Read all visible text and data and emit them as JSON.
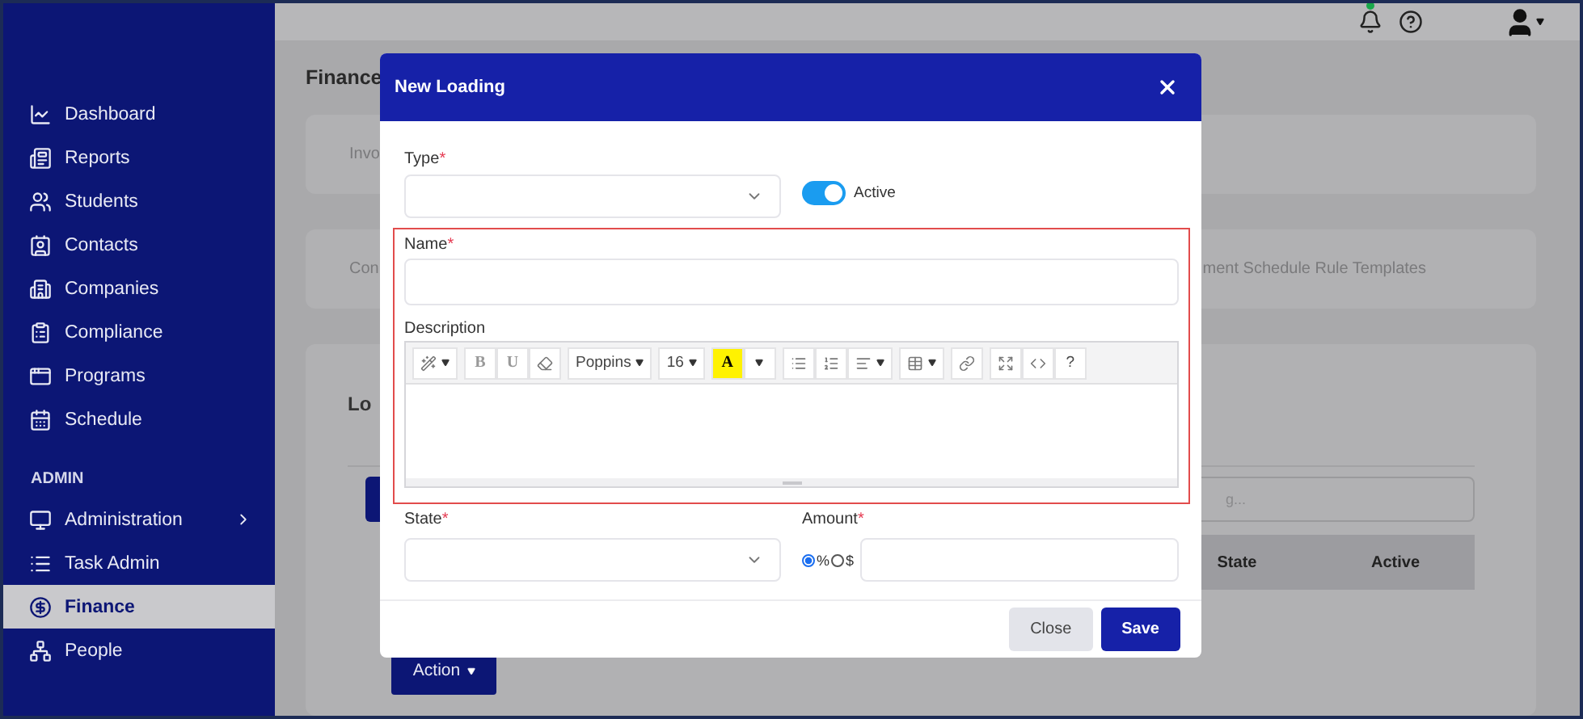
{
  "sidebar": {
    "items": [
      {
        "label": "Dashboard",
        "selected": false
      },
      {
        "label": "Reports",
        "selected": false
      },
      {
        "label": "Students",
        "selected": false
      },
      {
        "label": "Contacts",
        "selected": false
      },
      {
        "label": "Companies",
        "selected": false
      },
      {
        "label": "Compliance",
        "selected": false
      },
      {
        "label": "Programs",
        "selected": false
      },
      {
        "label": "Schedule",
        "selected": false
      }
    ],
    "section": "ADMIN",
    "admin_items": [
      {
        "label": "Administration",
        "selected": false,
        "expandable": true
      },
      {
        "label": "Task Admin",
        "selected": false,
        "expandable": false
      },
      {
        "label": "Finance",
        "selected": true,
        "expandable": false
      },
      {
        "label": "People",
        "selected": false,
        "expandable": false
      }
    ]
  },
  "header": {
    "notification_dot": true
  },
  "page": {
    "title": "Finance",
    "card_1": {
      "text": "Invo"
    },
    "card_2": {
      "left": "Con",
      "right": "ment Schedule Rule Templates"
    },
    "panel": {
      "title": "Lo",
      "search": {
        "placeholder": "g..."
      },
      "table_columns": [
        "State",
        "Active"
      ],
      "action_button": "Action"
    }
  },
  "modal": {
    "title": "New Loading",
    "type": {
      "label": "Type",
      "required_mark": "*"
    },
    "active": {
      "label": "Active",
      "on": true
    },
    "name": {
      "label": "Name",
      "required_mark": "*"
    },
    "description": {
      "label": "Description",
      "toolbar": [
        [
          {
            "kind": "wand",
            "dropdown": true
          }
        ],
        [
          {
            "kind": "text",
            "label": "B",
            "dropdown": false
          },
          {
            "kind": "text",
            "label": "U",
            "dropdown": false
          },
          {
            "kind": "eraser",
            "dropdown": false
          }
        ],
        [
          {
            "kind": "text",
            "label": "Poppins",
            "dropdown": true
          }
        ],
        [
          {
            "kind": "text",
            "label": "16",
            "dropdown": true
          }
        ],
        [
          {
            "kind": "highlight",
            "label": "A",
            "dropdown": false
          },
          {
            "kind": "caret",
            "dropdown": true
          }
        ],
        [
          {
            "kind": "bullets",
            "dropdown": false
          },
          {
            "kind": "numbers",
            "dropdown": false
          },
          {
            "kind": "align",
            "dropdown": true
          }
        ],
        [
          {
            "kind": "table",
            "dropdown": true
          }
        ],
        [
          {
            "kind": "link",
            "dropdown": false
          }
        ],
        [
          {
            "kind": "expand",
            "dropdown": false
          },
          {
            "kind": "code",
            "dropdown": false
          },
          {
            "kind": "text",
            "label": "?",
            "dropdown": false
          }
        ]
      ]
    },
    "state": {
      "label": "State",
      "required_mark": "*"
    },
    "amount": {
      "label": "Amount",
      "required_mark": "*",
      "units": [
        {
          "label": "%",
          "selected": true
        },
        {
          "label": "$",
          "selected": false
        }
      ]
    },
    "buttons": [
      {
        "label": "Close",
        "kind": "secondary"
      },
      {
        "label": "Save",
        "kind": "primary"
      }
    ]
  }
}
